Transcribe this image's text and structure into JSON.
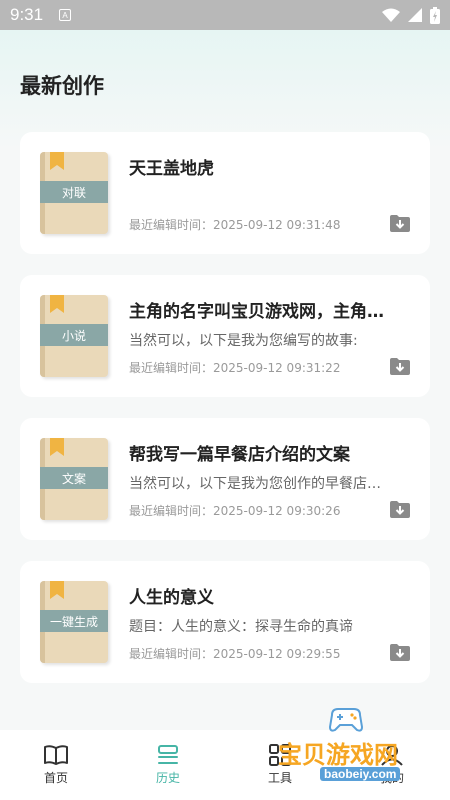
{
  "status_bar": {
    "time": "9:31",
    "notification_icon": "a-icon"
  },
  "page": {
    "title": "最新创作"
  },
  "cards": [
    {
      "book_label": "对联",
      "title": "天王盖地虎",
      "subtitle": "",
      "time": "最近编辑时间：2025-09-12 09:31:48"
    },
    {
      "book_label": "小说",
      "title": "主角的名字叫宝贝游戏网，主角…",
      "subtitle": "当然可以，以下是我为您编写的故事:",
      "time": "最近编辑时间：2025-09-12 09:31:22"
    },
    {
      "book_label": "文案",
      "title": "帮我写一篇早餐店介绍的文案",
      "subtitle": "当然可以，以下是我为您创作的早餐店…",
      "time": "最近编辑时间：2025-09-12 09:30:26"
    },
    {
      "book_label": "一键生成",
      "title": "人生的意义",
      "subtitle": "题目：人生的意义：探寻生命的真谛",
      "time": "最近编辑时间：2025-09-12 09:29:55"
    }
  ],
  "nav": {
    "items": [
      {
        "label": "首页",
        "icon": "book-icon",
        "active": false
      },
      {
        "label": "历史",
        "icon": "history-icon",
        "active": true
      },
      {
        "label": "工具",
        "icon": "grid-icon",
        "active": false
      },
      {
        "label": "我的",
        "icon": "user-icon",
        "active": false
      }
    ]
  },
  "watermark": {
    "text": "宝贝游戏网",
    "url": "baobeiy.com"
  },
  "colors": {
    "accent": "#46b5a6",
    "book_band": "#8aa7a6",
    "bookmark": "#f0b442",
    "watermark": "#f6a622"
  }
}
